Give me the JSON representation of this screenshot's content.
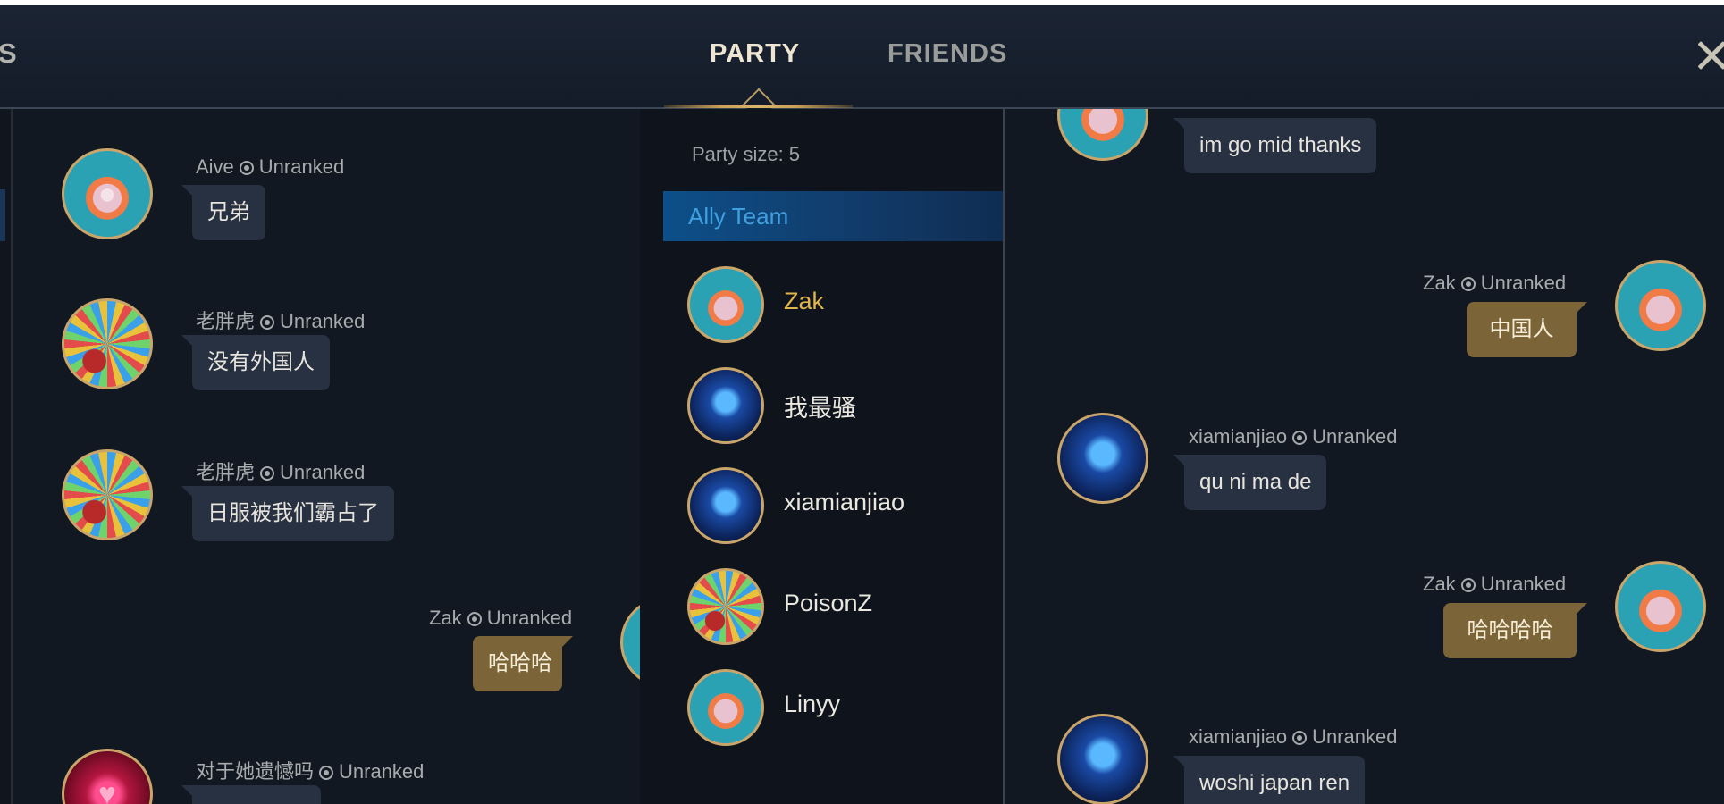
{
  "header": {
    "left_cut_label": "S",
    "tabs": [
      {
        "label": "PARTY",
        "active": true
      },
      {
        "label": "FRIENDS",
        "active": false
      }
    ],
    "close_icon": "close-x-icon"
  },
  "left_chat": {
    "messages": [
      {
        "author": "Aive",
        "rank": "Unranked",
        "text": "兄弟",
        "avatar": "poro-icon",
        "own": false
      },
      {
        "author": "老胖虎",
        "rank": "Unranked",
        "text": "没有外国人",
        "avatar": "confetti-icon",
        "own": false
      },
      {
        "author": "老胖虎",
        "rank": "Unranked",
        "text": "日服被我们霸占了",
        "avatar": "confetti-icon",
        "own": false
      },
      {
        "author": "Zak",
        "rank": "Unranked",
        "text": "哈哈哈",
        "avatar": "poro-icon",
        "own": true
      },
      {
        "author": "对于她遗憾吗",
        "rank": "Unranked",
        "text": "",
        "avatar": "heart-icon",
        "own": false
      }
    ]
  },
  "party": {
    "size_label": "Party size: 5",
    "team_label": "Ally Team",
    "members": [
      {
        "name": "Zak",
        "avatar": "poro-icon",
        "self": true
      },
      {
        "name": "我最骚",
        "avatar": "ice-icon",
        "self": false
      },
      {
        "name": "xiamianjiao",
        "avatar": "ice-icon",
        "self": false
      },
      {
        "name": "PoisonZ",
        "avatar": "confetti-icon",
        "self": false
      },
      {
        "name": "Linyy",
        "avatar": "poro-icon",
        "self": false
      }
    ]
  },
  "right_chat": {
    "messages": [
      {
        "author": "",
        "rank": "",
        "text": "im go mid thanks",
        "avatar": "poro-icon",
        "own": false
      },
      {
        "author": "Zak",
        "rank": "Unranked",
        "text": "中国人",
        "avatar": "poro-icon",
        "own": true
      },
      {
        "author": "xiamianjiao",
        "rank": "Unranked",
        "text": "qu ni ma de",
        "avatar": "ice-icon",
        "own": false
      },
      {
        "author": "Zak",
        "rank": "Unranked",
        "text": "哈哈哈哈",
        "avatar": "poro-icon",
        "own": true
      },
      {
        "author": "xiamianjiao",
        "rank": "Unranked",
        "text": "woshi japan ren",
        "avatar": "ice-icon",
        "own": false
      }
    ]
  },
  "colors": {
    "background": "#161b25",
    "gold_accent": "#c8a154",
    "own_bubble": "#7a6438",
    "other_bubble": "#283141",
    "ally_team_blue": "#0e4f89",
    "self_name_gold": "#e1b74c"
  }
}
